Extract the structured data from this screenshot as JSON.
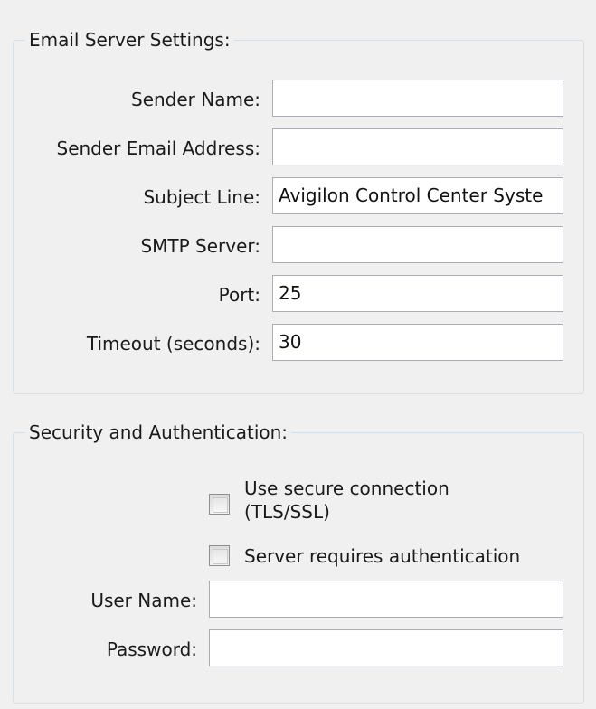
{
  "email_server": {
    "title": "Email Server Settings:",
    "fields": [
      {
        "label": "Sender Name:",
        "value": ""
      },
      {
        "label": "Sender Email Address:",
        "value": ""
      },
      {
        "label": "Subject Line:",
        "value": "Avigilon Control Center Syste"
      },
      {
        "label": "SMTP Server:",
        "value": ""
      },
      {
        "label": "Port:",
        "value": "25"
      },
      {
        "label": "Timeout (seconds):",
        "value": "30"
      }
    ]
  },
  "security": {
    "title": "Security and Authentication:",
    "checkboxes": [
      {
        "label_line1": "Use secure connection",
        "label_line2": "(TLS/SSL)",
        "checked": false
      },
      {
        "label": "Server requires authentication",
        "checked": false
      }
    ],
    "fields": [
      {
        "label": "User Name:",
        "value": ""
      },
      {
        "label": "Password:",
        "value": ""
      }
    ]
  }
}
